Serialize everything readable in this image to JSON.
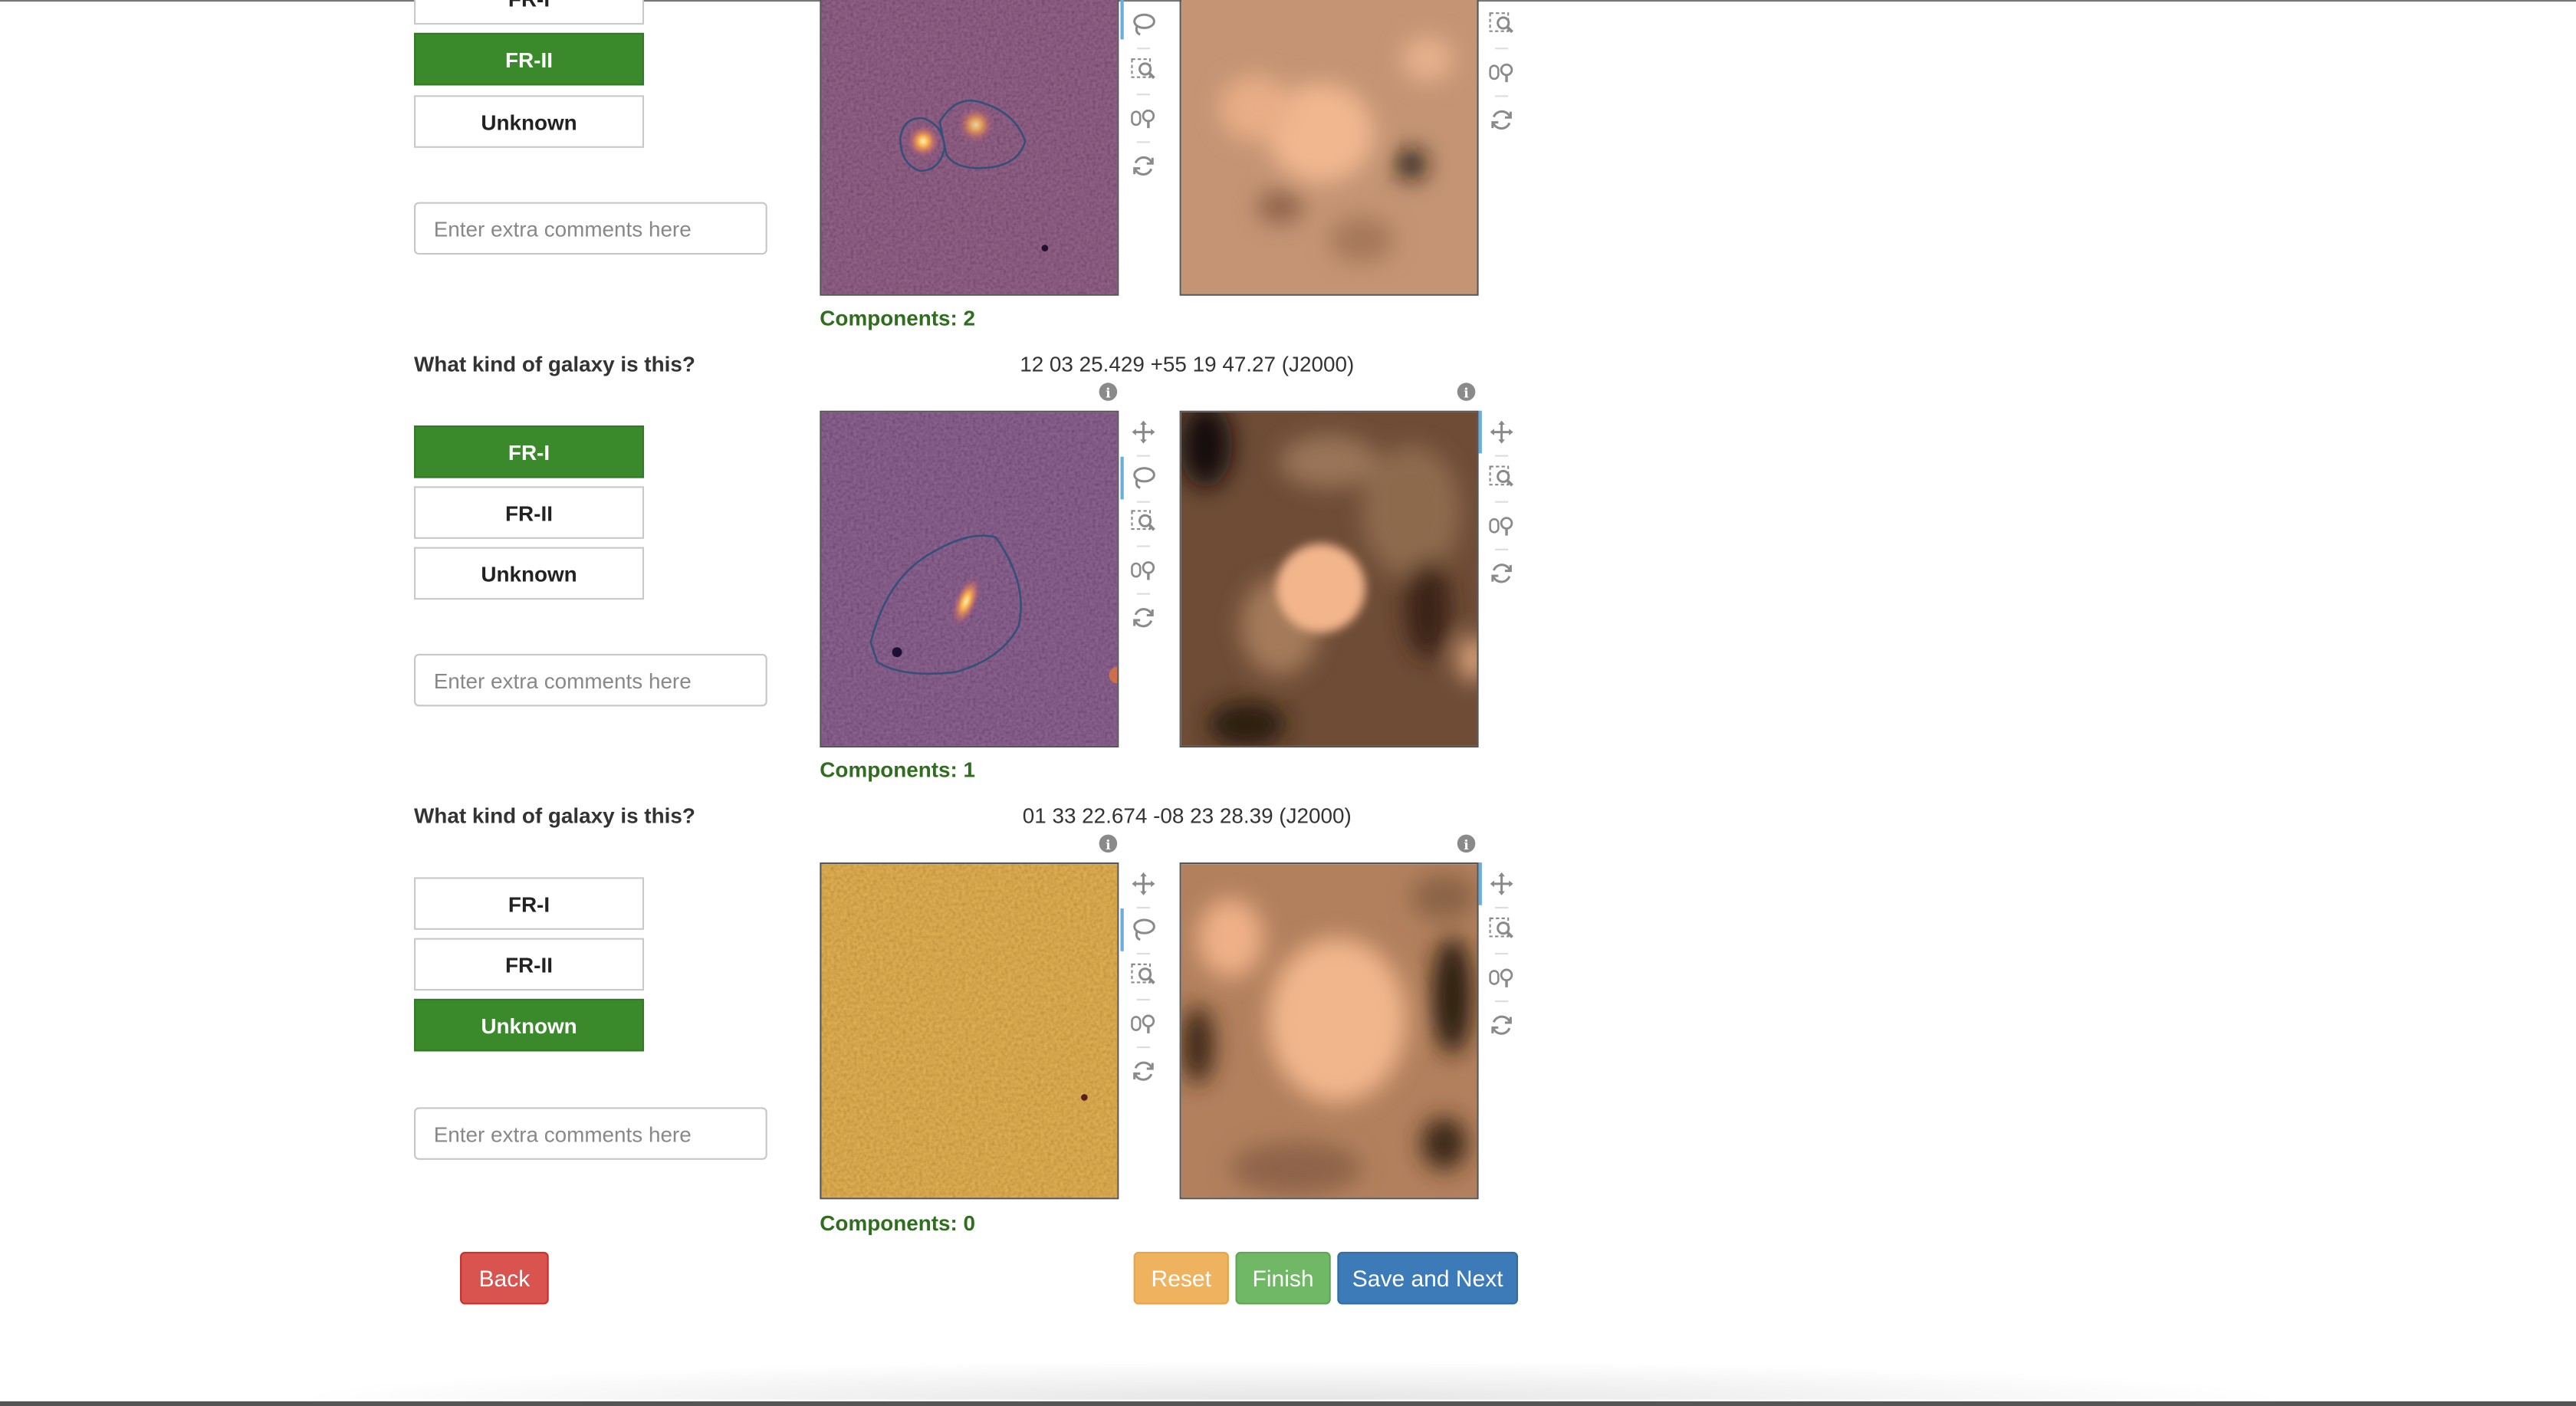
{
  "question": "What kind of galaxy is this?",
  "comment_placeholder": "Enter extra comments here",
  "options": [
    "FR-I",
    "FR-II",
    "Unknown"
  ],
  "sources": [
    {
      "coords": "",
      "selected": "FR-II",
      "components": "Components: 2"
    },
    {
      "coords": "12 03 25.429 +55 19 47.27 (J2000)",
      "selected": "FR-I",
      "components": "Components: 1"
    },
    {
      "coords": "01 33 22.674 -08 23 28.39 (J2000)",
      "selected": "Unknown",
      "components": "Components: 0"
    }
  ],
  "buttons": {
    "back": "Back",
    "reset": "Reset",
    "finish": "Finish",
    "save_next": "Save and Next"
  },
  "info_glyph": "i",
  "icons": [
    "move-icon",
    "lasso-icon",
    "box-zoom-icon",
    "wheel-zoom-icon",
    "reset-icon",
    "info-icon"
  ],
  "colors": {
    "selected": "#3a8a2c",
    "components_text": "#2f6e1f",
    "back": "#d9534f",
    "reset": "#efb35f",
    "finish": "#71b866",
    "save_next": "#3d7ab8"
  }
}
